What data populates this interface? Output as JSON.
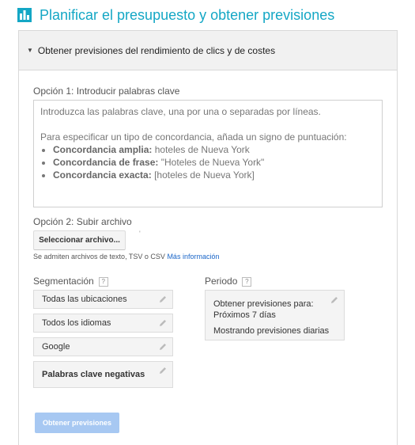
{
  "header": {
    "title": "Planificar el presupuesto y obtener previsiones",
    "icon": "bar-chart-icon",
    "accent": "#14a7c5"
  },
  "section": {
    "title": "Obtener previsiones del rendimiento de clics y de costes"
  },
  "option1": {
    "label": "Opción 1: Introducir palabras clave",
    "placeholder_line1": "Introduzca las palabras clave, una por una o separadas por líneas.",
    "placeholder_line2": "Para especificar un tipo de concordancia, añada un signo de puntuación:",
    "match_types": [
      {
        "name": "Concordancia amplia:",
        "example": "hoteles de Nueva York"
      },
      {
        "name": "Concordancia de frase:",
        "example": "\"Hoteles de Nueva York\""
      },
      {
        "name": "Concordancia exacta:",
        "example": "[hoteles de Nueva York]"
      }
    ]
  },
  "option2": {
    "label": "Opción 2: Subir archivo",
    "button_label": "Seleccionar archivo...",
    "note": "Se admiten archivos de texto, TSV o CSV",
    "more_info_link": "Más información"
  },
  "targeting": {
    "label": "Segmentación",
    "help": "?",
    "items": [
      {
        "label": "Todas las ubicaciones"
      },
      {
        "label": "Todos los idiomas"
      },
      {
        "label": "Google"
      },
      {
        "label": "Palabras clave negativas"
      }
    ]
  },
  "period": {
    "label": "Periodo",
    "help": "?",
    "line1": "Obtener previsiones para:",
    "line2": "Próximos 7 días",
    "line3": "Mostrando previsiones diarias"
  },
  "submit": {
    "label": "Obtener previsiones",
    "color": "#a7c8f2"
  }
}
